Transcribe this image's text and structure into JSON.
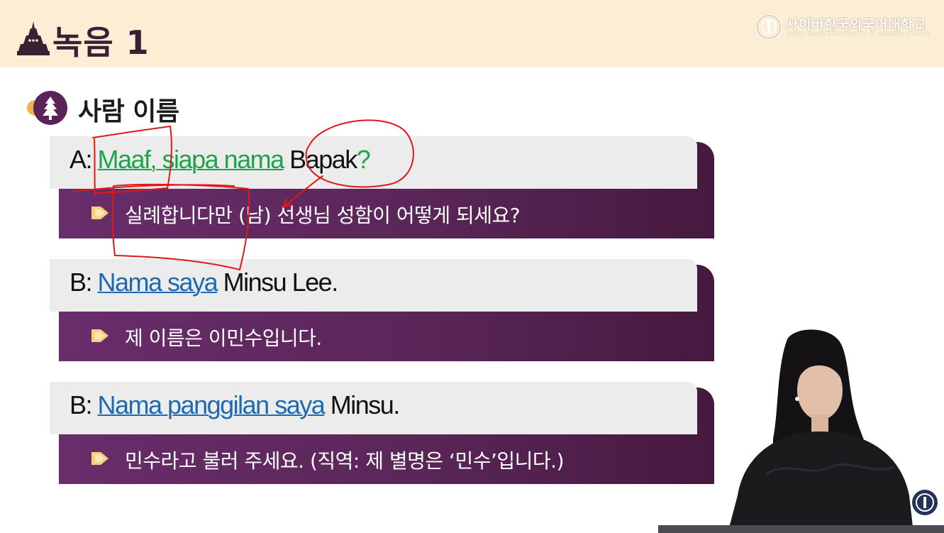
{
  "header": {
    "title": "녹음 1",
    "logo_name": "사이버한국외국어대학교",
    "logo_sub": "CYBER HANKUK UNIVERSITY OF FOREIGN STUDIES"
  },
  "section": {
    "title": "사람 이름"
  },
  "dialogue": [
    {
      "speaker": "A: ",
      "highlight": "Maaf, siapa nama",
      "tail": " Bapak",
      "end_mark": "?",
      "translation": "실례합니다만 (남) 선생님 성함이 어떻게 되세요?"
    },
    {
      "speaker": "B: ",
      "highlight": "Nama saya",
      "tail": " Minsu Lee.",
      "end_mark": "",
      "translation": "제 이름은 이민수입니다."
    },
    {
      "speaker": "B: ",
      "highlight": "Nama panggilan saya",
      "tail": " Minsu.",
      "end_mark": "",
      "translation": "민수라고 불러 주세요. (직역: 제 별명은 ‘민수’입니다.)"
    }
  ],
  "colors": {
    "header_bg": "#fbeed4",
    "purple": "#5e2860",
    "highlight_green": "#1aa64a",
    "highlight_blue": "#1e6ab0",
    "annotation_red": "#e01818"
  },
  "icons": [
    "temple-icon",
    "university-emblem-icon",
    "tree-badge-icon",
    "arrow-bullet-icon"
  ]
}
